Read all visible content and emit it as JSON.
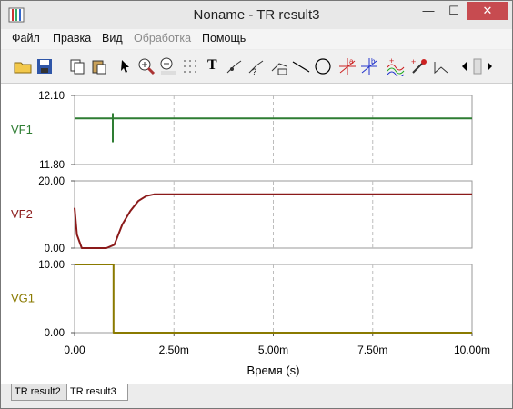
{
  "window": {
    "title": "Noname - TR result3",
    "min_glyph": "—",
    "max_glyph": "☐",
    "close_glyph": "✕"
  },
  "menu": {
    "file": "Файл",
    "edit": "Правка",
    "view": "Вид",
    "processing": "Обработка",
    "help": "Помощь"
  },
  "toolbar": {
    "text_tool": "T"
  },
  "plots": [
    {
      "label": "VF1",
      "color": "#2e7d32",
      "y_top": "12.10",
      "y_bottom": "11.80"
    },
    {
      "label": "VF2",
      "color": "#8b1a1a",
      "y_top": "20.00",
      "y_bottom": "0.00"
    },
    {
      "label": "VG1",
      "color": "#8a7a00",
      "y_top": "10.00",
      "y_bottom": "0.00"
    }
  ],
  "x_axis": {
    "ticks": [
      "0.00",
      "2.50m",
      "5.00m",
      "7.50m",
      "10.00m"
    ],
    "label": "Время (s)"
  },
  "tabs": [
    {
      "label": "TR result2"
    },
    {
      "label": "TR result3"
    }
  ],
  "chart_data": {
    "type": "line",
    "x_unit": "s",
    "xlim": [
      0,
      0.01
    ],
    "xlabel": "Время (s)",
    "panels": [
      {
        "series": [
          {
            "name": "VF1",
            "x": [
              0,
              0.00096,
              0.00096,
              0.00096,
              0.00096,
              0.01
            ],
            "y": [
              12.0,
              12.0,
              12.02,
              11.9,
              12.0,
              12.0
            ]
          }
        ],
        "ylim": [
          11.8,
          12.1
        ]
      },
      {
        "series": [
          {
            "name": "VF2",
            "x": [
              0,
              6e-05,
              0.00018,
              0.0008,
              0.001,
              0.0012,
              0.0014,
              0.0016,
              0.0018,
              0.002,
              0.01
            ],
            "y": [
              12,
              4,
              0,
              0,
              1,
              7,
              11,
              14,
              15.5,
              16,
              16
            ]
          }
        ],
        "ylim": [
          0,
          20
        ]
      },
      {
        "series": [
          {
            "name": "VG1",
            "x": [
              0,
              0.00098,
              0.00098,
              0.01
            ],
            "y": [
              10,
              10,
              0,
              0
            ]
          }
        ],
        "ylim": [
          0,
          10
        ]
      }
    ]
  }
}
